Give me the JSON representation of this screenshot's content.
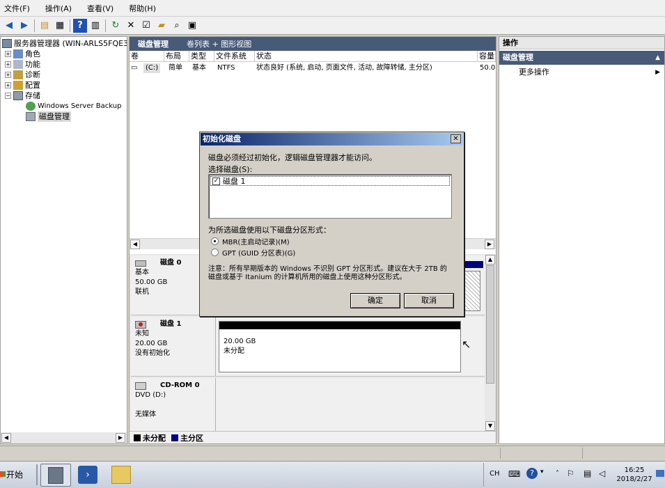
{
  "menu": {
    "file": "文件(F)",
    "action": "操作(A)",
    "view": "查看(V)",
    "help": "帮助(H)"
  },
  "tree": {
    "root": "服务器管理器 (WIN-ARLS5FQE3R",
    "roles": "角色",
    "features": "功能",
    "diagnostics": "诊断",
    "config": "配置",
    "storage": "存储",
    "backup": "Windows Server Backup",
    "disk_mgmt": "磁盘管理"
  },
  "center": {
    "title": "磁盘管理",
    "view_mode": "卷列表 + 图形视图",
    "columns": [
      "卷",
      "布局",
      "类型",
      "文件系统",
      "状态",
      "容量"
    ],
    "volume_row": {
      "volume": "(C:)",
      "layout": "简单",
      "type": "基本",
      "fs": "NTFS",
      "status": "状态良好 (系统, 启动, 页面文件, 活动, 故障转储, 主分区)",
      "capacity": "50.0"
    }
  },
  "disks": {
    "disk0": {
      "name": "磁盘 0",
      "kind": "基本",
      "size": "50.00 GB",
      "state": "联机"
    },
    "disk1": {
      "name": "磁盘 1",
      "kind": "未知",
      "size": "20.00 GB",
      "state": "没有初始化",
      "part_size": "20.00 GB",
      "part_state": "未分配"
    },
    "cdrom": {
      "name": "CD-ROM 0",
      "kind": "DVD (D:)",
      "state": "无媒体"
    }
  },
  "legend": {
    "unallocated": "未分配",
    "primary": "主分区"
  },
  "actions": {
    "title": "操作",
    "section": "磁盘管理",
    "more": "更多操作"
  },
  "dialog": {
    "title": "初始化磁盘",
    "message": "磁盘必须经过初始化，逻辑磁盘管理器才能访问。",
    "select_label": "选择磁盘(S):",
    "disk_item": "磁盘 1",
    "partition_label": "为所选磁盘使用以下磁盘分区形式：",
    "mbr": "MBR(主启动记录)(M)",
    "gpt": "GPT (GUID 分区表)(G)",
    "note": "注意：所有早期版本的 Windows 不识别 GPT 分区形式。建议在大于 2TB 的磁盘或基于 Itanium 的计算机所用的磁盘上使用这种分区形式。",
    "ok": "确定",
    "cancel": "取消"
  },
  "taskbar": {
    "start": "开始",
    "lang": "CH",
    "time": "16:25",
    "date": "2018/2/27"
  },
  "colors": {
    "accent": "#0a246a",
    "header": "#475a78",
    "primary_partition": "#000080",
    "unallocated": "#000000"
  }
}
